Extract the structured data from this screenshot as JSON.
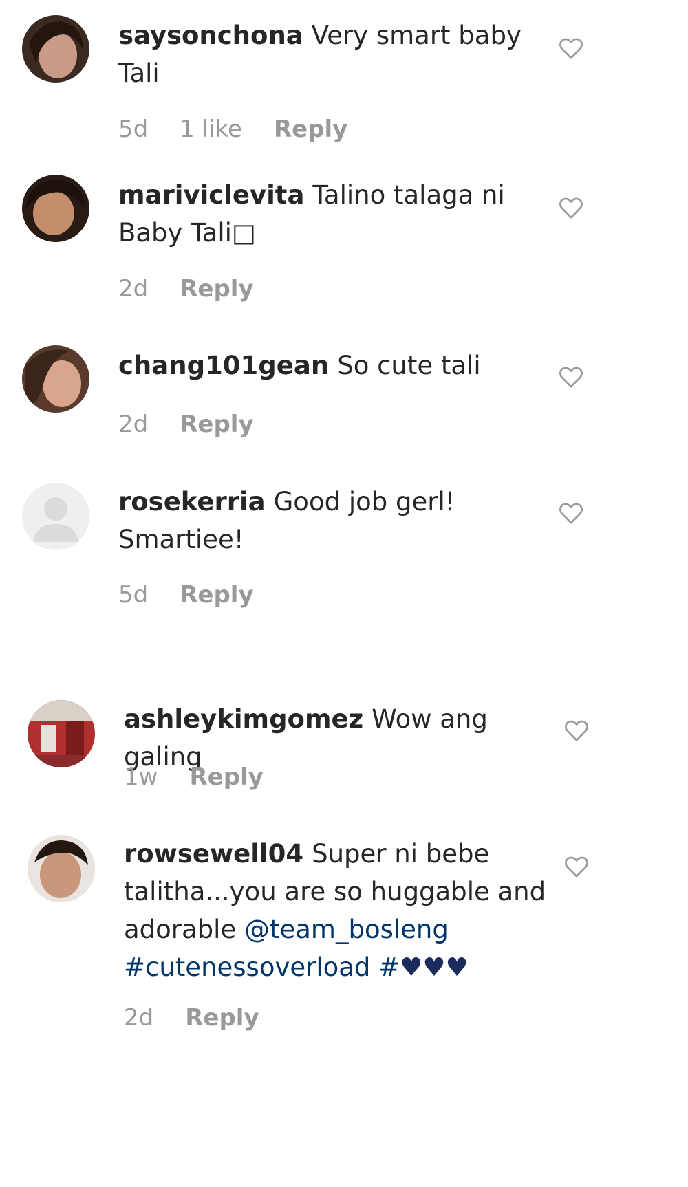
{
  "comments": [
    {
      "username": "saysonchona",
      "text_lines": [
        "Very smart baby",
        "Tali"
      ],
      "time": "5d",
      "likes": "1 like",
      "reply": "Reply",
      "avatar_icon": "profile-photo",
      "like_icon": "heart-outline-icon"
    },
    {
      "username": "mariviclevita",
      "text_lines": [
        "Talino talaga ni",
        "Baby Tali□"
      ],
      "time": "2d",
      "reply": "Reply",
      "avatar_icon": "profile-photo",
      "like_icon": "heart-outline-icon"
    },
    {
      "username": "chang101gean",
      "text_lines": [
        "So cute tali"
      ],
      "time": "2d",
      "reply": "Reply",
      "avatar_icon": "profile-photo",
      "like_icon": "heart-outline-icon"
    },
    {
      "username": "rosekerria",
      "text_lines": [
        "Good job gerl!",
        "Smartiee!"
      ],
      "time": "5d",
      "reply": "Reply",
      "avatar_icon": "default-profile-photo",
      "like_icon": "heart-outline-icon"
    },
    {
      "username": "ashleykimgomez",
      "text_lines": [
        "Wow ang galing"
      ],
      "time": "1w",
      "reply": "Reply",
      "avatar_icon": "profile-photo",
      "like_icon": "heart-outline-icon"
    },
    {
      "username": "rowsewell04",
      "text_line1": "Super ni bebe",
      "text_line2": "talitha...you are so huggable and",
      "text_line3_pre": "adorable ",
      "mention": "@team_bosleng",
      "hashtag": "#cutenessoverload",
      "hashtag2": "#",
      "hearts": "♥♥♥",
      "time": "2d",
      "reply": "Reply",
      "avatar_icon": "profile-photo",
      "like_icon": "heart-outline-icon"
    }
  ],
  "colors": {
    "text": "#262626",
    "meta": "#999999",
    "link": "#003569",
    "heart_outline": "#999999",
    "emoji_heart": "#1a2b5c"
  }
}
